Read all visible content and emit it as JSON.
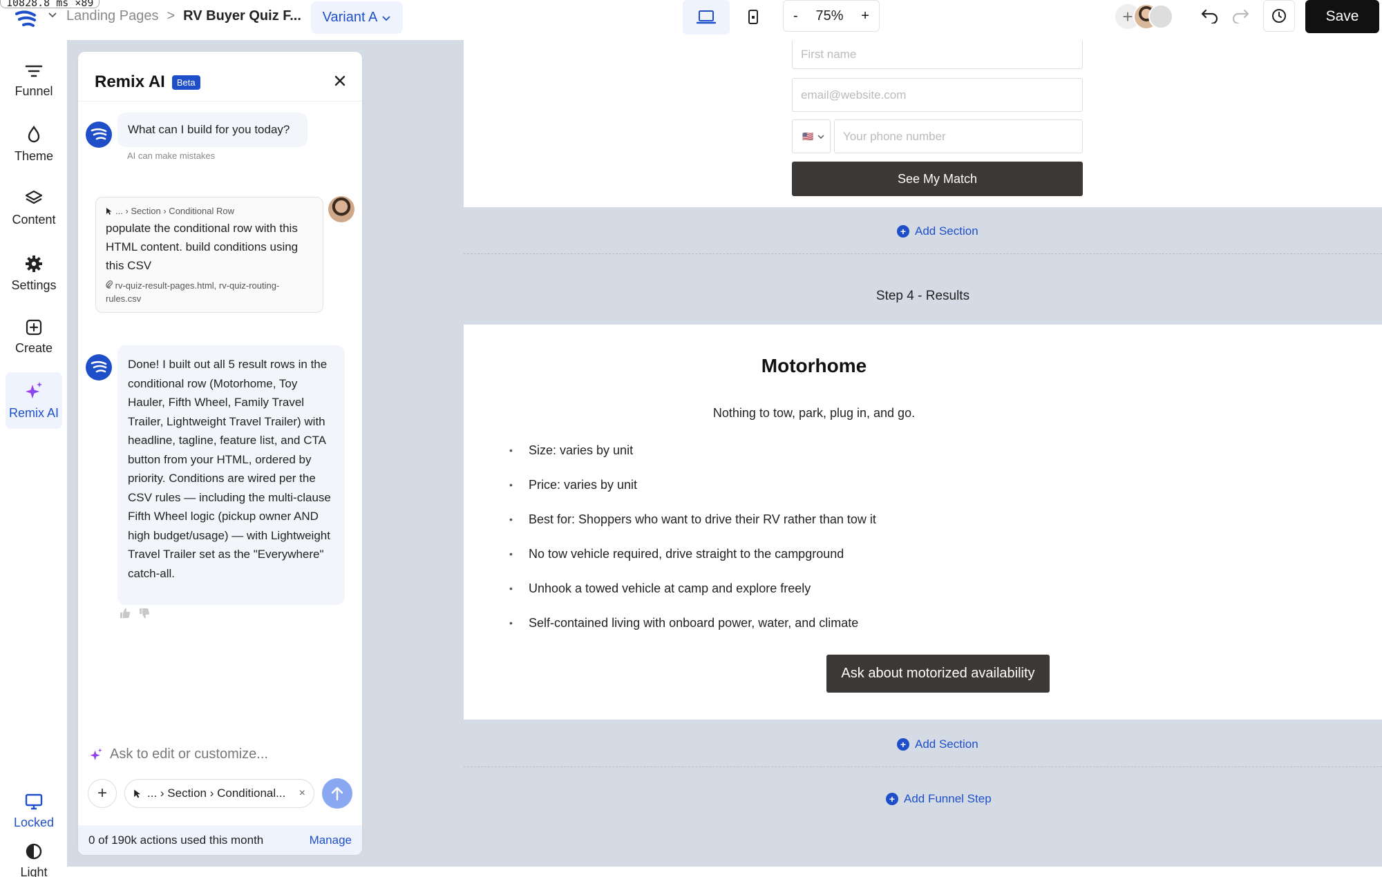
{
  "debug": {
    "text": "10828.8 ms ×89"
  },
  "header": {
    "breadcrumb_parent": "Landing Pages",
    "breadcrumb_separator": ">",
    "breadcrumb_current": "RV Buyer Quiz F...",
    "variant_label": "Variant A",
    "zoom_minus": "-",
    "zoom_value": "75%",
    "zoom_plus": "+",
    "add_collaborator": "+",
    "save_label": "Save"
  },
  "sidebar": {
    "items": [
      {
        "label": "Funnel",
        "icon": "funnel-icon"
      },
      {
        "label": "Theme",
        "icon": "droplet-icon"
      },
      {
        "label": "Content",
        "icon": "layers-icon"
      },
      {
        "label": "Settings",
        "icon": "gear-icon"
      },
      {
        "label": "Create",
        "icon": "plus-square-icon"
      },
      {
        "label": "Remix AI",
        "icon": "sparkle-icon"
      }
    ],
    "bottom": [
      {
        "label": "Locked",
        "icon": "monitor-icon"
      },
      {
        "label": "Light",
        "icon": "contrast-icon"
      }
    ]
  },
  "ai_panel": {
    "title": "Remix AI",
    "badge": "Beta",
    "greeting": "What can I build for you today?",
    "disclaimer": "AI can make mistakes",
    "user_message": {
      "context": "... › Section › Conditional Row",
      "text": "populate the conditional row with this HTML content. build conditions using this CSV",
      "attachments": "rv-quiz-result-pages.html, rv-quiz-routing-rules.csv"
    },
    "reply": "Done! I built out all 5 result rows in the conditional row (Motorhome, Toy Hauler, Fifth Wheel, Family Travel Trailer, Lightweight Travel Trailer) with headline, tagline, feature list, and CTA button from your HTML, ordered by priority. Conditions are wired per the CSV rules — including the multi-clause Fifth Wheel logic (pickup owner AND high budget/usage) — with Lightweight Travel Trailer set as the \"Everywhere\" catch-all.",
    "input_placeholder": "Ask to edit or customize...",
    "context_chip": "... › Section › Conditional...",
    "chip_close": "×",
    "plus_label": "+",
    "usage": "0 of 190k actions used this month",
    "manage": "Manage"
  },
  "page": {
    "form": {
      "first_name_placeholder": "First name",
      "email_placeholder": "email@website.com",
      "phone_placeholder": "Your phone number",
      "country_flag": "🇺🇸",
      "submit_label": "See My Match"
    },
    "add_section": "Add Section",
    "step_label": "Step 4 - Results",
    "result": {
      "title": "Motorhome",
      "tagline": "Nothing to tow, park, plug in, and go.",
      "features": [
        "Size: varies by unit",
        "Price: varies by unit",
        "Best for: Shoppers who want to drive their RV rather than tow it",
        "No tow vehicle required, drive straight to the campground",
        "Unhook a towed vehicle at camp and explore freely",
        "Self-contained living with onboard power, water, and climate"
      ],
      "cta": "Ask about motorized availability"
    },
    "add_funnel_step": "Add Funnel Step"
  },
  "colors": {
    "accent": "#1f4fc8",
    "canvas": "#d5dbe5",
    "dark_button": "#3c3836"
  }
}
